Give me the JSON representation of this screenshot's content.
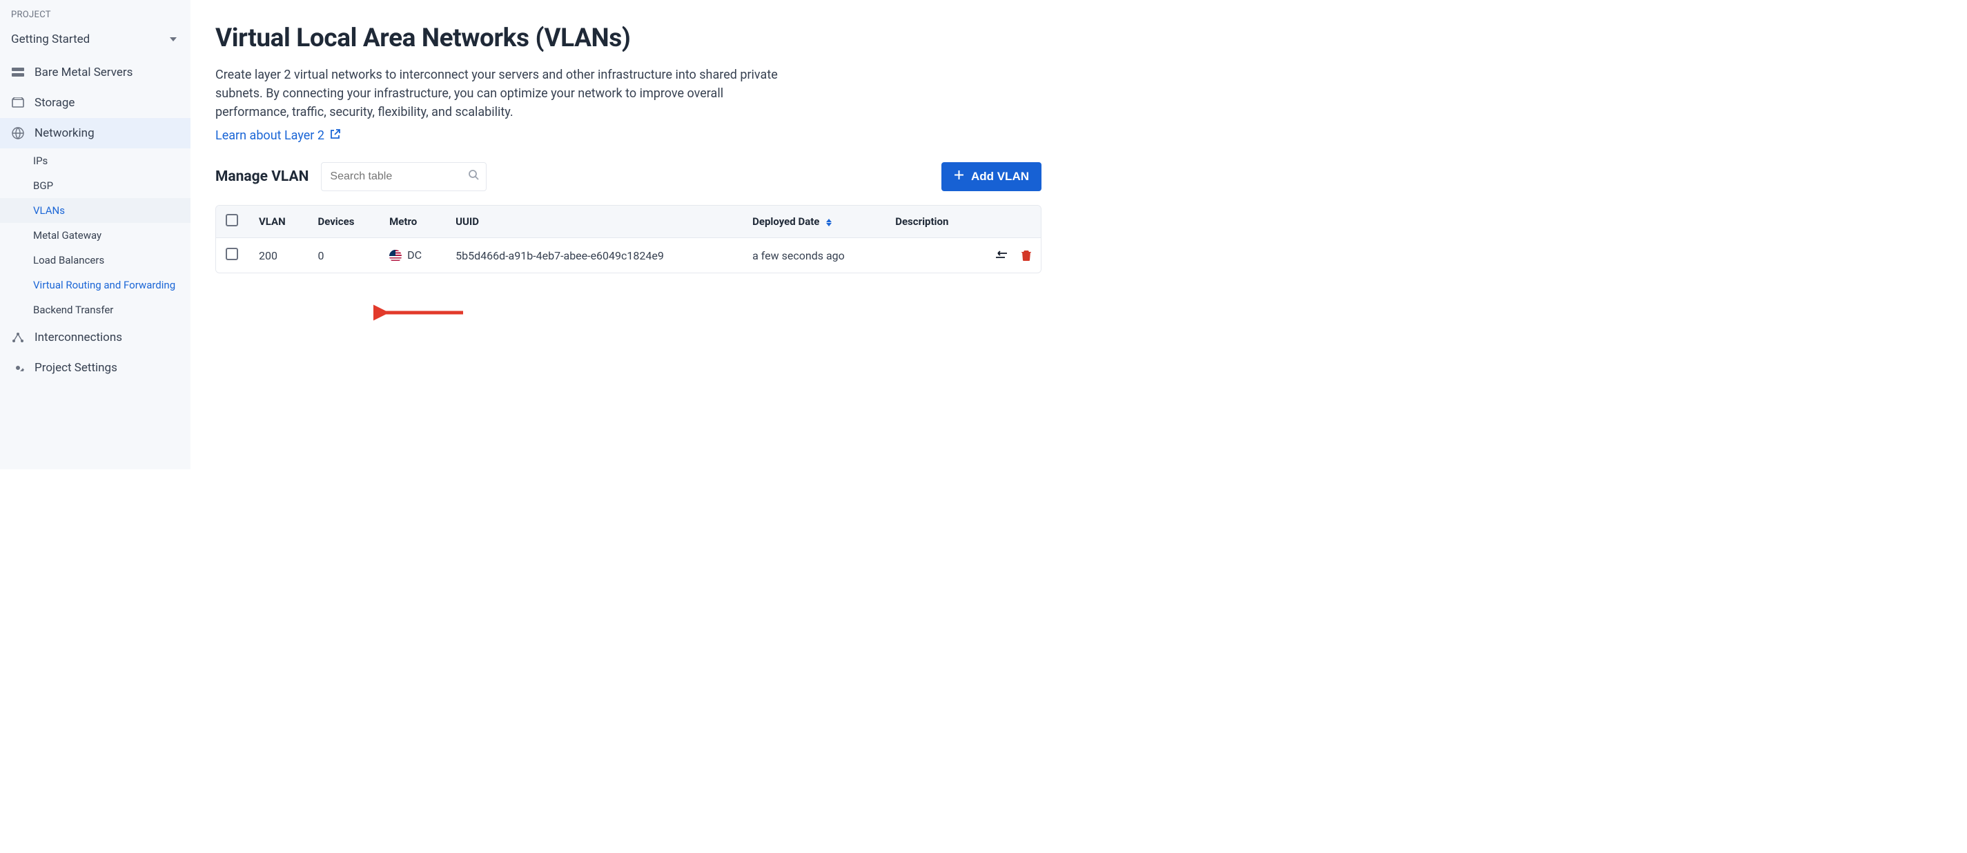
{
  "sidebar": {
    "project_label": "PROJECT",
    "project_name": "Getting Started",
    "items": [
      {
        "id": "bare-metal",
        "label": "Bare Metal Servers"
      },
      {
        "id": "storage",
        "label": "Storage"
      },
      {
        "id": "networking",
        "label": "Networking",
        "active": true,
        "children": [
          {
            "id": "ips",
            "label": "IPs"
          },
          {
            "id": "bgp",
            "label": "BGP"
          },
          {
            "id": "vlans",
            "label": "VLANs",
            "active": true
          },
          {
            "id": "metal-gateway",
            "label": "Metal Gateway"
          },
          {
            "id": "load-balancers",
            "label": "Load Balancers"
          },
          {
            "id": "vrf",
            "label": "Virtual Routing and Forwarding",
            "highlight": true
          },
          {
            "id": "backend-transfer",
            "label": "Backend Transfer"
          }
        ]
      },
      {
        "id": "interconnections",
        "label": "Interconnections"
      },
      {
        "id": "project-settings",
        "label": "Project Settings"
      }
    ]
  },
  "page": {
    "title": "Virtual Local Area Networks (VLANs)",
    "description": "Create layer 2 virtual networks to interconnect your servers and other infrastructure into shared private subnets. By connecting your infrastructure, you can optimize your network to improve overall performance, traffic, security, flexibility, and scalability.",
    "learn_link": "Learn about Layer 2"
  },
  "toolbar": {
    "manage_label": "Manage VLAN",
    "search_placeholder": "Search table",
    "add_button": "Add VLAN"
  },
  "table": {
    "columns": {
      "vlan": "VLAN",
      "devices": "Devices",
      "metro": "Metro",
      "uuid": "UUID",
      "deployed": "Deployed Date",
      "description": "Description"
    },
    "rows": [
      {
        "vlan": "200",
        "devices": "0",
        "metro": "DC",
        "metro_flag": "us",
        "uuid": "5b5d466d-a91b-4eb7-abee-e6049c1824e9",
        "deployed": "a few seconds ago",
        "description": ""
      }
    ]
  },
  "annotation": {
    "arrow_target": "Virtual Routing and Forwarding"
  }
}
